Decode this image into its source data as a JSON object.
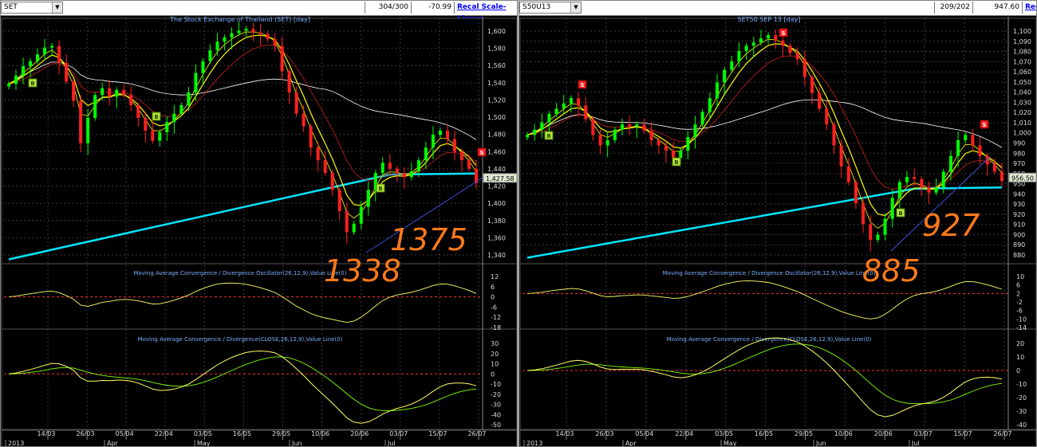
{
  "colors": {
    "bg": "#000000",
    "grid": "#3a3a3a",
    "bull": "#00ff00",
    "bear": "#ff2020",
    "ema_fast": "#ffff00",
    "ema_mid": "#cc2020",
    "ema_slow": "#ffffff",
    "ema_long": "#00e5ff",
    "osc": "#ffff66",
    "signal": "#7fff00",
    "trend": "#3d4fd6",
    "annot": "#ff7a1a",
    "title": "#7db0ff"
  },
  "left": {
    "toolbar": {
      "symbol": "SET",
      "ratio": "304/300",
      "change": "-70.99",
      "scale_link": "Recal Scale-Linear"
    },
    "chart_title": "The Stock Exchange of Thailand (SET) [day]",
    "macd_title": "Moving Average Convergence / Divergence Oscillator(26,12,9),Value Line(0)",
    "macd2_title": "Moving Average Convergence / Divergence(CLOSE,26,12,9),Value Line(0)",
    "last_price": "1,427.58",
    "annotations": [
      "1375",
      "1338"
    ],
    "price_ticks": [
      "1,600",
      "1,580",
      "1,560",
      "1,540",
      "1,520",
      "1,500",
      "1,480",
      "1,460",
      "1,440",
      "1,420",
      "1,400",
      "1,380",
      "1,360",
      "1,340"
    ],
    "osc_ticks": [
      "12",
      "6",
      "0",
      "-6",
      "-12",
      "-18"
    ],
    "macd_ticks": [
      "30",
      "20",
      "10",
      "0",
      "-10",
      "-20",
      "-30",
      "-40",
      "-50"
    ],
    "date_labels": [
      "14/03",
      "26/03",
      "05/04",
      "22/04",
      "03/05",
      "16/05",
      "29/05",
      "10/06",
      "20/06",
      "03/07",
      "15/07",
      "26/07"
    ],
    "month_labels": [
      "2013",
      "Apr",
      "May",
      "Jun",
      "Jul"
    ],
    "buy_marker": "B",
    "sell_marker": "S"
  },
  "right": {
    "toolbar": {
      "symbol": "S50U13",
      "ratio": "209/202",
      "change": "947.60",
      "scale_link": "Recal Scale-Linear"
    },
    "chart_title": "SET50 SEP 13 [day]",
    "macd_title": "Moving Average Convergence / Divergence Oscillator(26,12,9),Value Line(0)",
    "macd2_title": "Moving Average Convergence / Divergence(CLOSE,26,12,9),Value Line(0)",
    "last_price": "956.50",
    "annotations": [
      "927",
      "885"
    ],
    "price_ticks": [
      "1,100",
      "1,090",
      "1,080",
      "1,070",
      "1,060",
      "1,050",
      "1,040",
      "1,030",
      "1,020",
      "1,010",
      "1,000",
      "990",
      "980",
      "970",
      "960",
      "950",
      "940",
      "930",
      "920",
      "910",
      "900",
      "890",
      "880"
    ],
    "osc_ticks": [
      "10",
      "6",
      "2",
      "-2",
      "-6",
      "-10",
      "-14"
    ],
    "macd_ticks": [
      "20",
      "10",
      "0",
      "-10",
      "-20",
      "-30",
      "-40"
    ],
    "date_labels": [
      "14/03",
      "26/03",
      "05/04",
      "22/04",
      "03/05",
      "16/05",
      "29/05",
      "10/06",
      "20/06",
      "03/07",
      "15/07",
      "26/07"
    ],
    "month_labels": [
      "2013",
      "Apr",
      "May",
      "Jun",
      "Jul"
    ],
    "buy_marker": "B",
    "sell_marker": "S"
  },
  "chart_data": [
    {
      "type": "candlestick",
      "title": "The Stock Exchange of Thailand (SET) [day]",
      "ylim": [
        1330,
        1615
      ],
      "close": [
        1545,
        1555,
        1566,
        1572,
        1580,
        1588,
        1590,
        1570,
        1548,
        1525,
        1475,
        1505,
        1532,
        1540,
        1530,
        1538,
        1532,
        1520,
        1505,
        1490,
        1478,
        1488,
        1500,
        1510,
        1520,
        1535,
        1558,
        1572,
        1585,
        1595,
        1600,
        1605,
        1608,
        1610,
        1606,
        1604,
        1598,
        1590,
        1560,
        1535,
        1510,
        1495,
        1470,
        1455,
        1440,
        1420,
        1395,
        1370,
        1380,
        1400,
        1420,
        1440,
        1452,
        1445,
        1440,
        1435,
        1442,
        1455,
        1470,
        1485,
        1490,
        1480,
        1465,
        1455,
        1445,
        1428
      ]
    },
    {
      "type": "candlestick",
      "title": "SET50 SEP 13 [day]",
      "ylim": [
        875,
        1105
      ],
      "close": [
        1000,
        1005,
        1012,
        1020,
        1025,
        1030,
        1035,
        1028,
        1015,
        1000,
        990,
        995,
        1005,
        1010,
        1008,
        1010,
        1004,
        995,
        990,
        985,
        978,
        985,
        998,
        1010,
        1022,
        1035,
        1050,
        1062,
        1070,
        1080,
        1085,
        1088,
        1092,
        1095,
        1090,
        1085,
        1078,
        1072,
        1055,
        1040,
        1025,
        1010,
        990,
        970,
        955,
        935,
        915,
        900,
        905,
        920,
        940,
        955,
        960,
        958,
        950,
        945,
        950,
        965,
        980,
        995,
        1000,
        990,
        980,
        972,
        965,
        956
      ]
    }
  ]
}
